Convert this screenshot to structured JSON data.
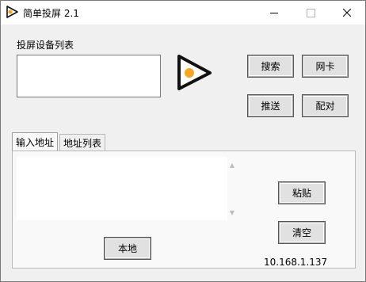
{
  "window": {
    "title": "简单投屏 2.1",
    "controls": {
      "minimize": "minimize",
      "maximize": "maximize",
      "close": "close"
    }
  },
  "device_list": {
    "label": "投屏设备列表",
    "items": []
  },
  "buttons": {
    "search": "搜索",
    "network_card": "网卡",
    "push": "推送",
    "pair": "配对",
    "paste": "粘贴",
    "clear": "清空",
    "local": "本地"
  },
  "tabs": [
    {
      "label": "输入地址",
      "active": true
    },
    {
      "label": "地址列表",
      "active": false
    }
  ],
  "address_input": {
    "value": ""
  },
  "status": {
    "ip_address": "10.168.1.137"
  },
  "colors": {
    "accent_orange": "#f5a623",
    "logo_stroke": "#111111",
    "titlebar_bg": "#ffffff",
    "window_bg": "#f0f0f0"
  },
  "icons": {
    "app": "play-triangle-icon",
    "logo": "play-triangle-icon",
    "close": "close-icon"
  }
}
